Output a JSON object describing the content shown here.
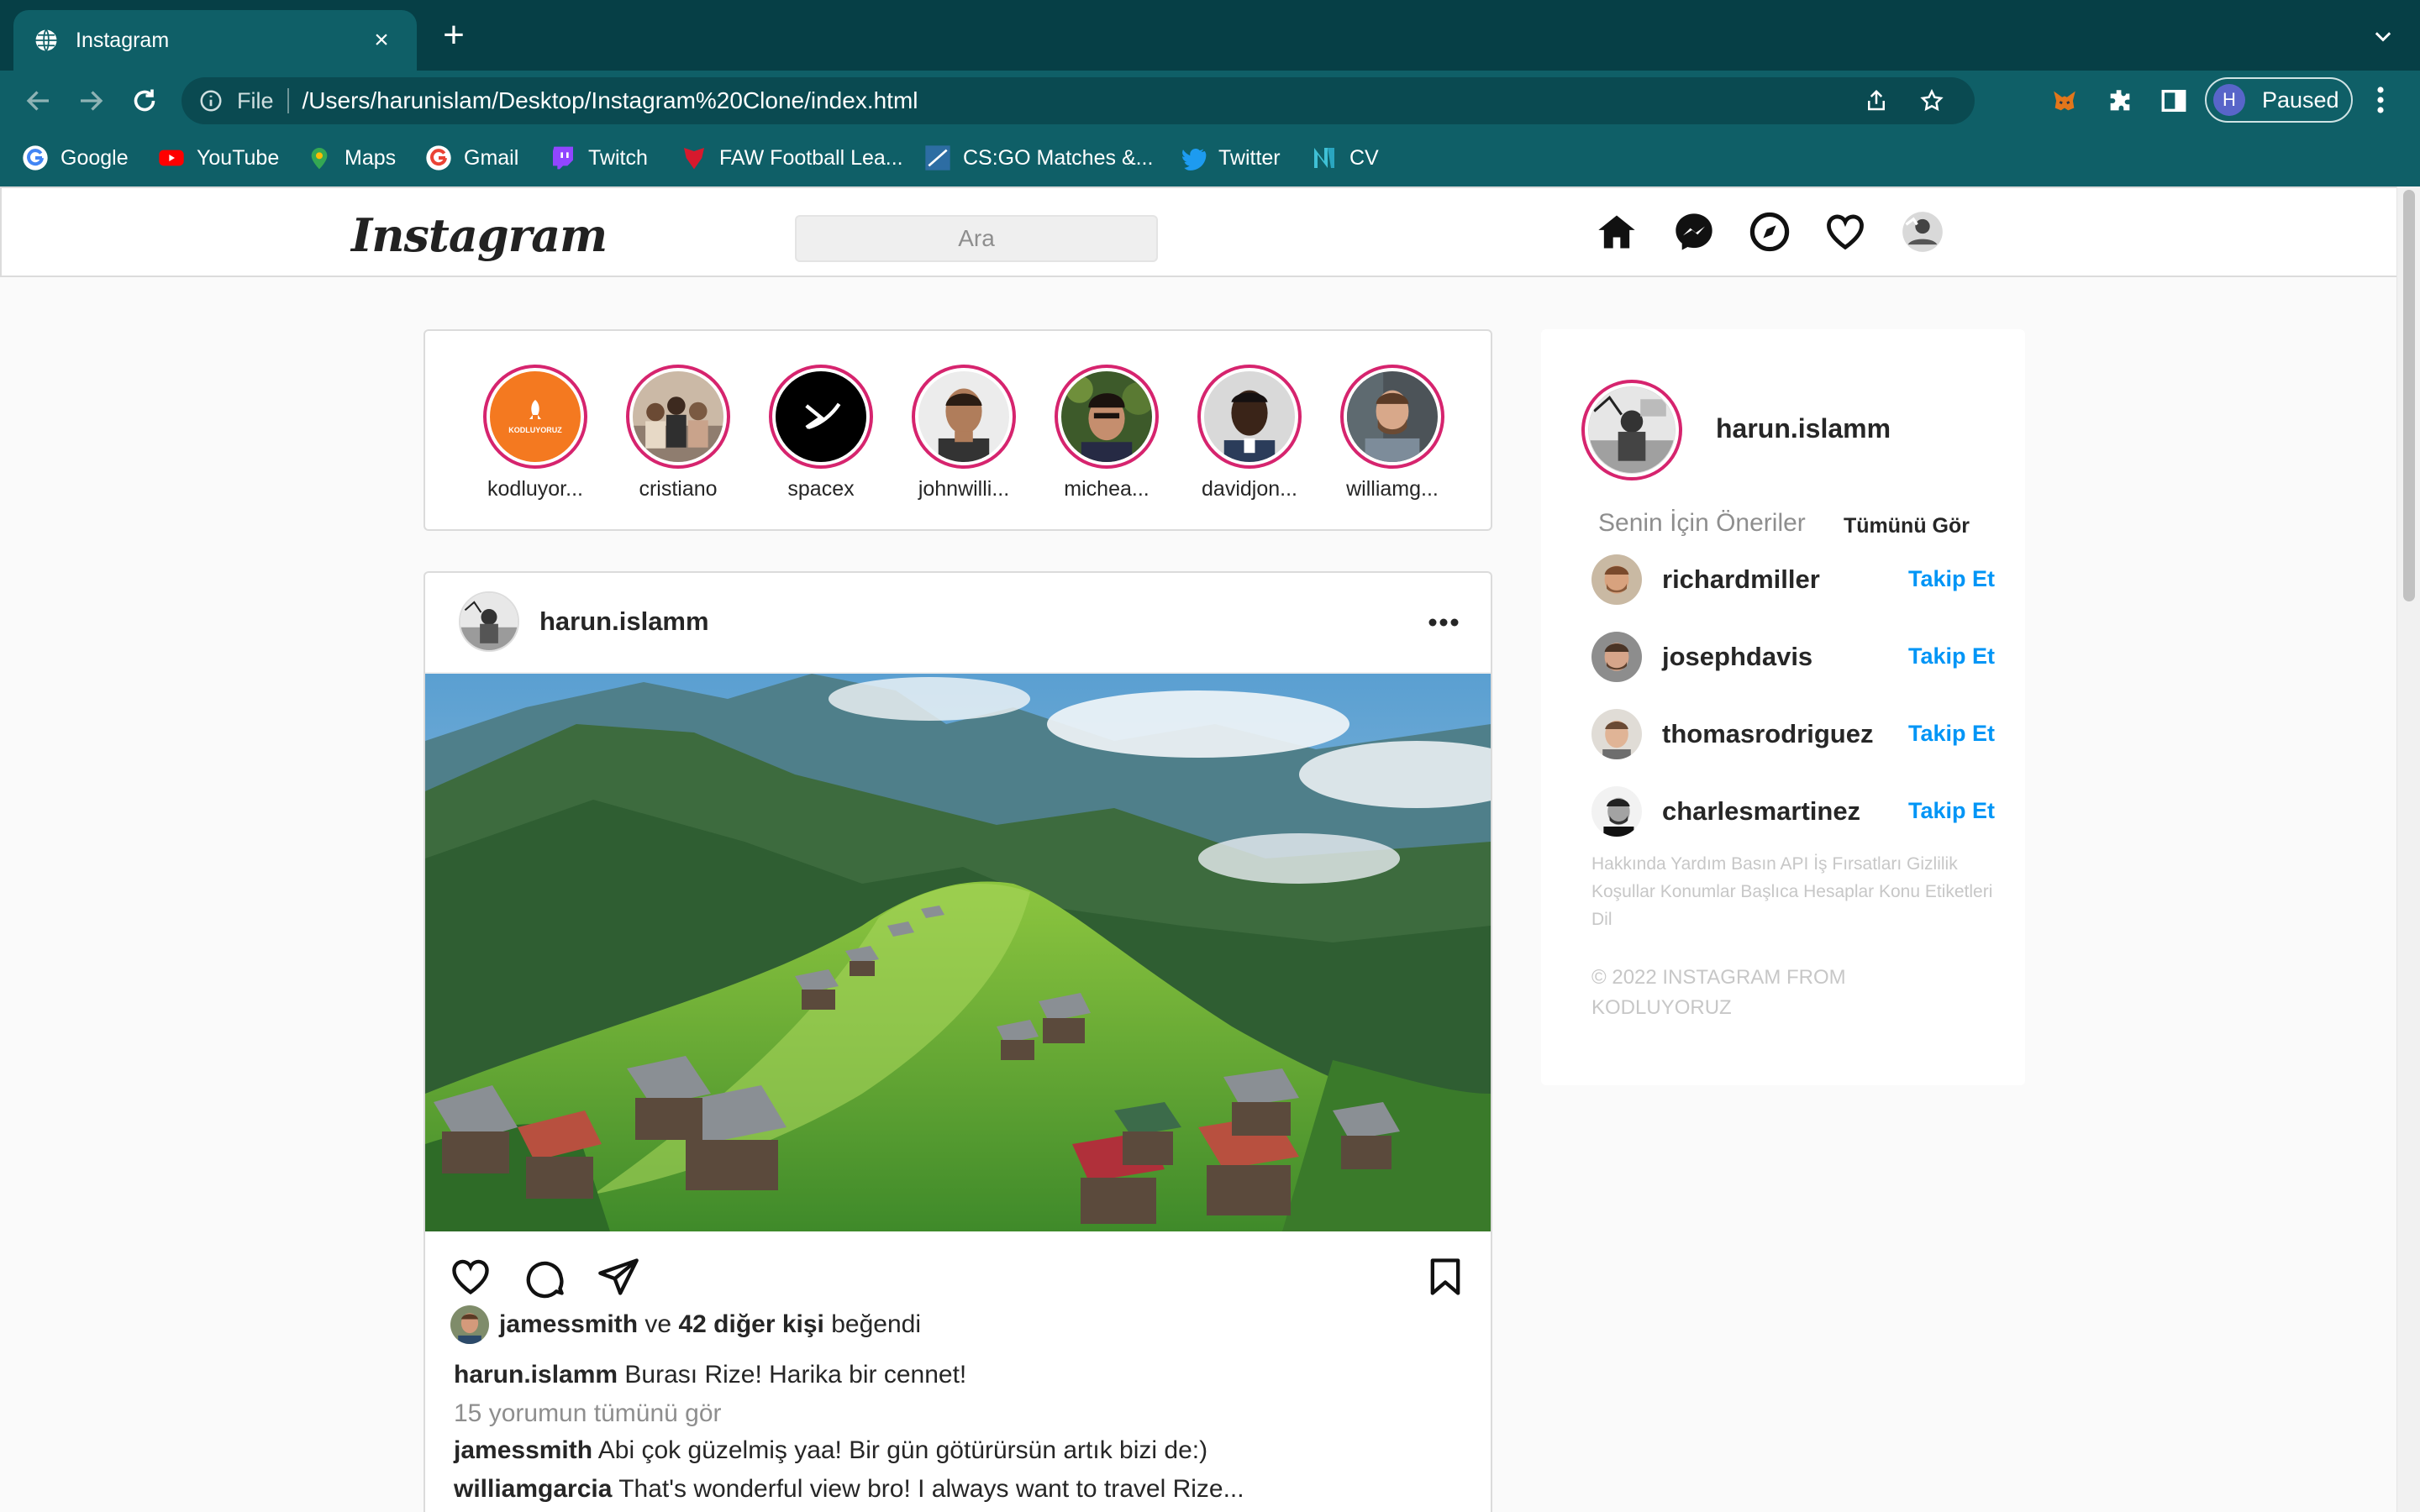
{
  "browser": {
    "tab_title": "Instagram",
    "tab_close": "×",
    "new_tab": "+",
    "omnibox_scheme": "File",
    "url": "/Users/harunislam/Desktop/Instagram%20Clone/index.html",
    "profile_initial": "H",
    "profile_status": "Paused",
    "bookmarks": [
      "Google",
      "YouTube",
      "Maps",
      "Gmail",
      "Twitch",
      "FAW Football Lea...",
      "CS:GO Matches &...",
      "Twitter",
      "CV"
    ]
  },
  "instagram": {
    "logo": "Instagram",
    "search_placeholder": "Ara",
    "nav_icons": [
      "home-icon",
      "messenger-icon",
      "explore-icon",
      "heart-icon",
      "profile-avatar"
    ],
    "stories": [
      {
        "name": "kodluyor...",
        "avatar": "kodluyoruz-logo",
        "logo_text": "KODLUYORUZ"
      },
      {
        "name": "cristiano",
        "avatar": "group-photo"
      },
      {
        "name": "spacex",
        "avatar": "spacex-logo"
      },
      {
        "name": "johnwilli...",
        "avatar": "person-photo"
      },
      {
        "name": "michea...",
        "avatar": "person-photo"
      },
      {
        "name": "davidjon...",
        "avatar": "person-photo"
      },
      {
        "name": "williamg...",
        "avatar": "person-photo"
      }
    ],
    "post": {
      "username": "harun.islamm",
      "liked_by_user": "jamessmith",
      "liked_by_connector": "ve",
      "liked_by_others": "42 diğer kişi",
      "liked_by_suffix": "beğendi",
      "caption_user": "harun.islamm",
      "caption_text": "Burası Rize! Harika bir cennet!",
      "view_all_comments": "15 yorumun tümünü gör",
      "comments": [
        {
          "user": "jamessmith",
          "text": "Abi çok güzelmiş yaa! Bir gün götürürsün artık bizi de:)"
        },
        {
          "user": "williamgarcia",
          "text": "That's wonderful view bro! I always want to travel Rize..."
        }
      ]
    },
    "sidebar": {
      "username": "harun.islamm",
      "suggestions_title": "Senin İçin Öneriler",
      "see_all": "Tümünü Gör",
      "suggestions": [
        {
          "name": "richardmiller",
          "action": "Takip Et"
        },
        {
          "name": "josephdavis",
          "action": "Takip Et"
        },
        {
          "name": "thomasrodriguez",
          "action": "Takip Et"
        },
        {
          "name": "charlesmartinez",
          "action": "Takip Et"
        }
      ],
      "footer_links": "Hakkında Yardım Basın API İş Fırsatları Gizlilik Koşullar Konumlar Başlıca Hesaplar Konu Etiketleri Dil",
      "copyright": "© 2022 INSTAGRAM FROM KODLUYORUZ"
    }
  },
  "colors": {
    "chrome_dark": "#063f46",
    "chrome_toolbar": "#0f5f67",
    "story_ring": "#d6246e",
    "follow_blue": "#0095f6"
  }
}
